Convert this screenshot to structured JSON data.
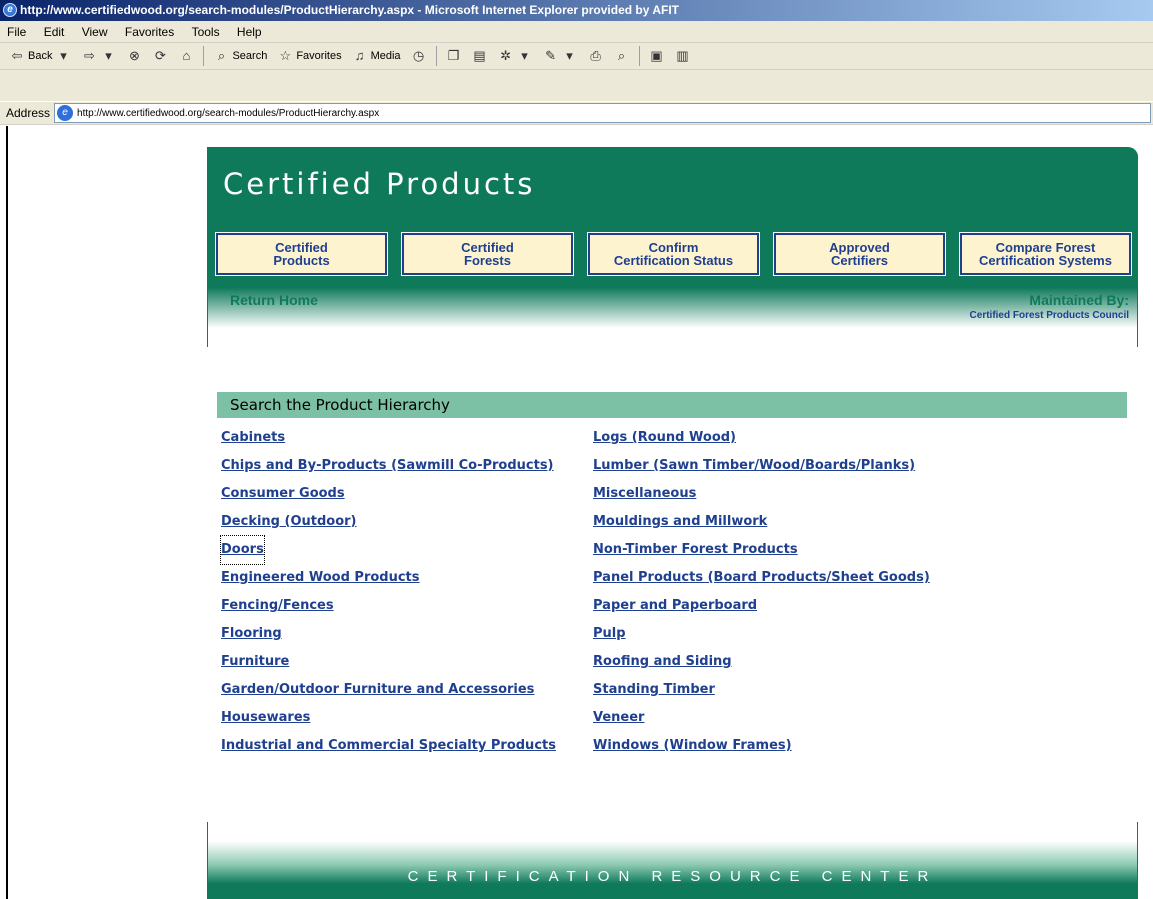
{
  "window": {
    "title": "http://www.certifiedwood.org/search-modules/ProductHierarchy.aspx - Microsoft Internet Explorer provided by AFIT"
  },
  "menu": [
    "File",
    "Edit",
    "View",
    "Favorites",
    "Tools",
    "Help"
  ],
  "toolbar": {
    "back": "Back",
    "search": "Search",
    "favorites": "Favorites",
    "media": "Media"
  },
  "address": {
    "label": "Address",
    "url": "http://www.certifiedwood.org/search-modules/ProductHierarchy.aspx"
  },
  "header": {
    "title": "Certified Products",
    "nav": [
      "Certified\nProducts",
      "Certified\nForests",
      "Confirm\nCertification Status",
      "Approved\nCertifiers",
      "Compare Forest\nCertification Systems"
    ],
    "return_home": "Return Home",
    "maintained_label": "Maintained By:",
    "maintained_value": "Certified Forest Products Council"
  },
  "hierarchy": {
    "heading": "Search the Product Hierarchy",
    "left": [
      "Cabinets",
      "Chips and By-Products (Sawmill Co-Products)",
      "Consumer Goods",
      "Decking (Outdoor)",
      "Doors",
      "Engineered Wood Products",
      "Fencing/Fences",
      "Flooring",
      "Furniture",
      "Garden/Outdoor Furniture and Accessories",
      "Housewares",
      "Industrial and Commercial Specialty Products"
    ],
    "right": [
      "Logs (Round Wood)",
      "Lumber (Sawn Timber/Wood/Boards/Planks)",
      "Miscellaneous",
      "Mouldings and Millwork",
      "Non-Timber Forest Products",
      "Panel Products (Board Products/Sheet Goods)",
      "Paper and Paperboard",
      "Pulp",
      "Roofing and Siding",
      "Standing Timber",
      "Veneer",
      "Windows (Window Frames)"
    ]
  },
  "footer": {
    "text": "CERTIFICATION RESOURCE CENTER"
  },
  "colors": {
    "brand_green": "#0f7a5a",
    "section_green": "#7cc0a6",
    "link_blue": "#1f3f8f",
    "button_fill": "#fdf3cf"
  }
}
